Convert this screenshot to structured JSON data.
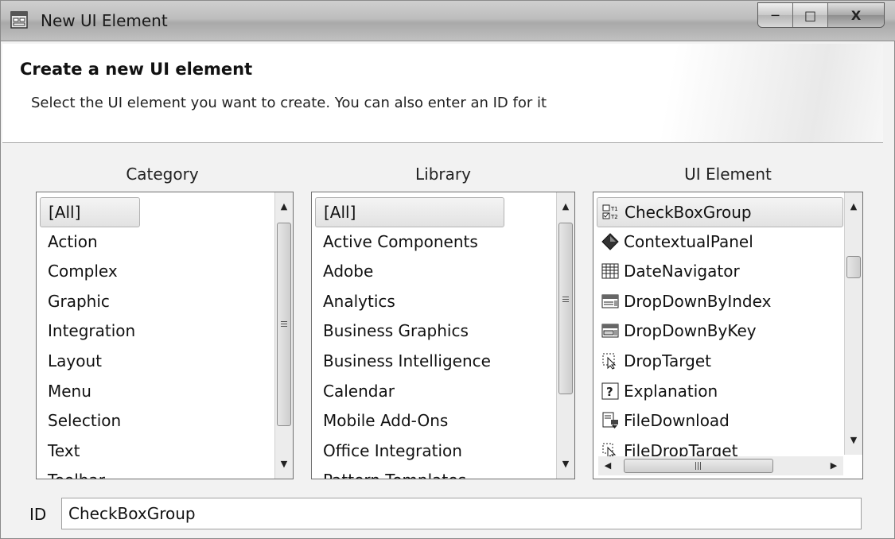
{
  "window": {
    "title": "New UI Element",
    "controls": {
      "minimize": "─",
      "maximize": "□",
      "close": "X"
    }
  },
  "banner": {
    "title": "Create a new UI element",
    "description": "Select the UI element you want to create. You can also enter an ID for it"
  },
  "columns": {
    "category": {
      "title": "Category",
      "selected": "[All]",
      "items": [
        "[All]",
        "Action",
        "Complex",
        "Graphic",
        "Integration",
        "Layout",
        "Menu",
        "Selection",
        "Text",
        "Toolbar"
      ]
    },
    "library": {
      "title": "Library",
      "selected": "[All]",
      "items": [
        "[All]",
        "Active Components",
        "Adobe",
        "Analytics",
        "Business Graphics",
        "Business Intelligence",
        "Calendar",
        "Mobile Add-Ons",
        "Office Integration",
        "Pattern Templates"
      ]
    },
    "ui_element": {
      "title": "UI Element",
      "selected": "CheckBoxGroup",
      "items": [
        {
          "label": "CheckBoxGroup",
          "icon": "checkboxgroup-icon"
        },
        {
          "label": "ContextualPanel",
          "icon": "diamond-icon"
        },
        {
          "label": "DateNavigator",
          "icon": "grid-calendar-icon"
        },
        {
          "label": "DropDownByIndex",
          "icon": "dropdown-index-icon"
        },
        {
          "label": "DropDownByKey",
          "icon": "dropdown-key-icon"
        },
        {
          "label": "DropTarget",
          "icon": "drop-target-icon"
        },
        {
          "label": "Explanation",
          "icon": "question-icon"
        },
        {
          "label": "FileDownload",
          "icon": "file-download-icon"
        },
        {
          "label": "FileDropTarget",
          "icon": "file-drop-target-icon"
        }
      ]
    }
  },
  "id_field": {
    "label": "ID",
    "value": "CheckBoxGroup"
  }
}
